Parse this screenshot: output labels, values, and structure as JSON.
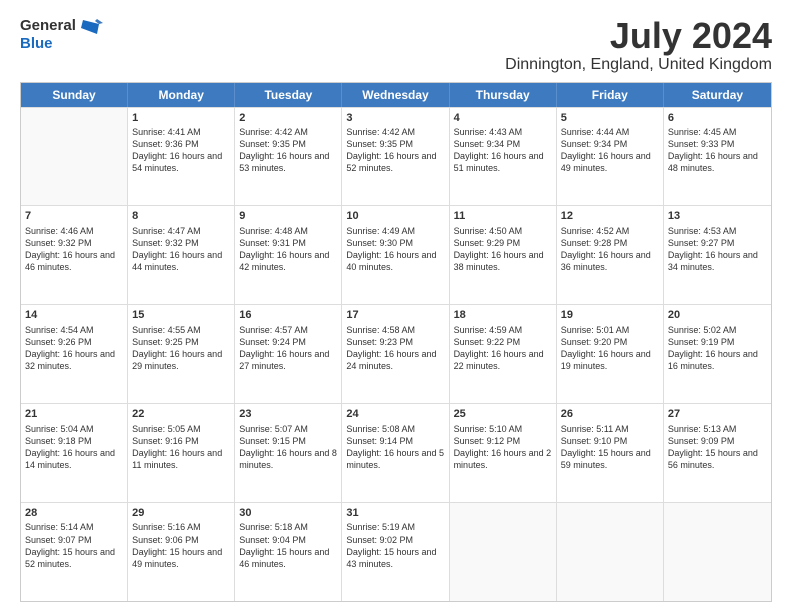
{
  "logo": {
    "line1": "General",
    "line2": "Blue"
  },
  "title": "July 2024",
  "subtitle": "Dinnington, England, United Kingdom",
  "days": [
    "Sunday",
    "Monday",
    "Tuesday",
    "Wednesday",
    "Thursday",
    "Friday",
    "Saturday"
  ],
  "weeks": [
    [
      {
        "num": "",
        "sunrise": "",
        "sunset": "",
        "daylight": ""
      },
      {
        "num": "1",
        "sunrise": "Sunrise: 4:41 AM",
        "sunset": "Sunset: 9:36 PM",
        "daylight": "Daylight: 16 hours and 54 minutes."
      },
      {
        "num": "2",
        "sunrise": "Sunrise: 4:42 AM",
        "sunset": "Sunset: 9:35 PM",
        "daylight": "Daylight: 16 hours and 53 minutes."
      },
      {
        "num": "3",
        "sunrise": "Sunrise: 4:42 AM",
        "sunset": "Sunset: 9:35 PM",
        "daylight": "Daylight: 16 hours and 52 minutes."
      },
      {
        "num": "4",
        "sunrise": "Sunrise: 4:43 AM",
        "sunset": "Sunset: 9:34 PM",
        "daylight": "Daylight: 16 hours and 51 minutes."
      },
      {
        "num": "5",
        "sunrise": "Sunrise: 4:44 AM",
        "sunset": "Sunset: 9:34 PM",
        "daylight": "Daylight: 16 hours and 49 minutes."
      },
      {
        "num": "6",
        "sunrise": "Sunrise: 4:45 AM",
        "sunset": "Sunset: 9:33 PM",
        "daylight": "Daylight: 16 hours and 48 minutes."
      }
    ],
    [
      {
        "num": "7",
        "sunrise": "Sunrise: 4:46 AM",
        "sunset": "Sunset: 9:32 PM",
        "daylight": "Daylight: 16 hours and 46 minutes."
      },
      {
        "num": "8",
        "sunrise": "Sunrise: 4:47 AM",
        "sunset": "Sunset: 9:32 PM",
        "daylight": "Daylight: 16 hours and 44 minutes."
      },
      {
        "num": "9",
        "sunrise": "Sunrise: 4:48 AM",
        "sunset": "Sunset: 9:31 PM",
        "daylight": "Daylight: 16 hours and 42 minutes."
      },
      {
        "num": "10",
        "sunrise": "Sunrise: 4:49 AM",
        "sunset": "Sunset: 9:30 PM",
        "daylight": "Daylight: 16 hours and 40 minutes."
      },
      {
        "num": "11",
        "sunrise": "Sunrise: 4:50 AM",
        "sunset": "Sunset: 9:29 PM",
        "daylight": "Daylight: 16 hours and 38 minutes."
      },
      {
        "num": "12",
        "sunrise": "Sunrise: 4:52 AM",
        "sunset": "Sunset: 9:28 PM",
        "daylight": "Daylight: 16 hours and 36 minutes."
      },
      {
        "num": "13",
        "sunrise": "Sunrise: 4:53 AM",
        "sunset": "Sunset: 9:27 PM",
        "daylight": "Daylight: 16 hours and 34 minutes."
      }
    ],
    [
      {
        "num": "14",
        "sunrise": "Sunrise: 4:54 AM",
        "sunset": "Sunset: 9:26 PM",
        "daylight": "Daylight: 16 hours and 32 minutes."
      },
      {
        "num": "15",
        "sunrise": "Sunrise: 4:55 AM",
        "sunset": "Sunset: 9:25 PM",
        "daylight": "Daylight: 16 hours and 29 minutes."
      },
      {
        "num": "16",
        "sunrise": "Sunrise: 4:57 AM",
        "sunset": "Sunset: 9:24 PM",
        "daylight": "Daylight: 16 hours and 27 minutes."
      },
      {
        "num": "17",
        "sunrise": "Sunrise: 4:58 AM",
        "sunset": "Sunset: 9:23 PM",
        "daylight": "Daylight: 16 hours and 24 minutes."
      },
      {
        "num": "18",
        "sunrise": "Sunrise: 4:59 AM",
        "sunset": "Sunset: 9:22 PM",
        "daylight": "Daylight: 16 hours and 22 minutes."
      },
      {
        "num": "19",
        "sunrise": "Sunrise: 5:01 AM",
        "sunset": "Sunset: 9:20 PM",
        "daylight": "Daylight: 16 hours and 19 minutes."
      },
      {
        "num": "20",
        "sunrise": "Sunrise: 5:02 AM",
        "sunset": "Sunset: 9:19 PM",
        "daylight": "Daylight: 16 hours and 16 minutes."
      }
    ],
    [
      {
        "num": "21",
        "sunrise": "Sunrise: 5:04 AM",
        "sunset": "Sunset: 9:18 PM",
        "daylight": "Daylight: 16 hours and 14 minutes."
      },
      {
        "num": "22",
        "sunrise": "Sunrise: 5:05 AM",
        "sunset": "Sunset: 9:16 PM",
        "daylight": "Daylight: 16 hours and 11 minutes."
      },
      {
        "num": "23",
        "sunrise": "Sunrise: 5:07 AM",
        "sunset": "Sunset: 9:15 PM",
        "daylight": "Daylight: 16 hours and 8 minutes."
      },
      {
        "num": "24",
        "sunrise": "Sunrise: 5:08 AM",
        "sunset": "Sunset: 9:14 PM",
        "daylight": "Daylight: 16 hours and 5 minutes."
      },
      {
        "num": "25",
        "sunrise": "Sunrise: 5:10 AM",
        "sunset": "Sunset: 9:12 PM",
        "daylight": "Daylight: 16 hours and 2 minutes."
      },
      {
        "num": "26",
        "sunrise": "Sunrise: 5:11 AM",
        "sunset": "Sunset: 9:10 PM",
        "daylight": "Daylight: 15 hours and 59 minutes."
      },
      {
        "num": "27",
        "sunrise": "Sunrise: 5:13 AM",
        "sunset": "Sunset: 9:09 PM",
        "daylight": "Daylight: 15 hours and 56 minutes."
      }
    ],
    [
      {
        "num": "28",
        "sunrise": "Sunrise: 5:14 AM",
        "sunset": "Sunset: 9:07 PM",
        "daylight": "Daylight: 15 hours and 52 minutes."
      },
      {
        "num": "29",
        "sunrise": "Sunrise: 5:16 AM",
        "sunset": "Sunset: 9:06 PM",
        "daylight": "Daylight: 15 hours and 49 minutes."
      },
      {
        "num": "30",
        "sunrise": "Sunrise: 5:18 AM",
        "sunset": "Sunset: 9:04 PM",
        "daylight": "Daylight: 15 hours and 46 minutes."
      },
      {
        "num": "31",
        "sunrise": "Sunrise: 5:19 AM",
        "sunset": "Sunset: 9:02 PM",
        "daylight": "Daylight: 15 hours and 43 minutes."
      },
      {
        "num": "",
        "sunrise": "",
        "sunset": "",
        "daylight": ""
      },
      {
        "num": "",
        "sunrise": "",
        "sunset": "",
        "daylight": ""
      },
      {
        "num": "",
        "sunrise": "",
        "sunset": "",
        "daylight": ""
      }
    ]
  ]
}
